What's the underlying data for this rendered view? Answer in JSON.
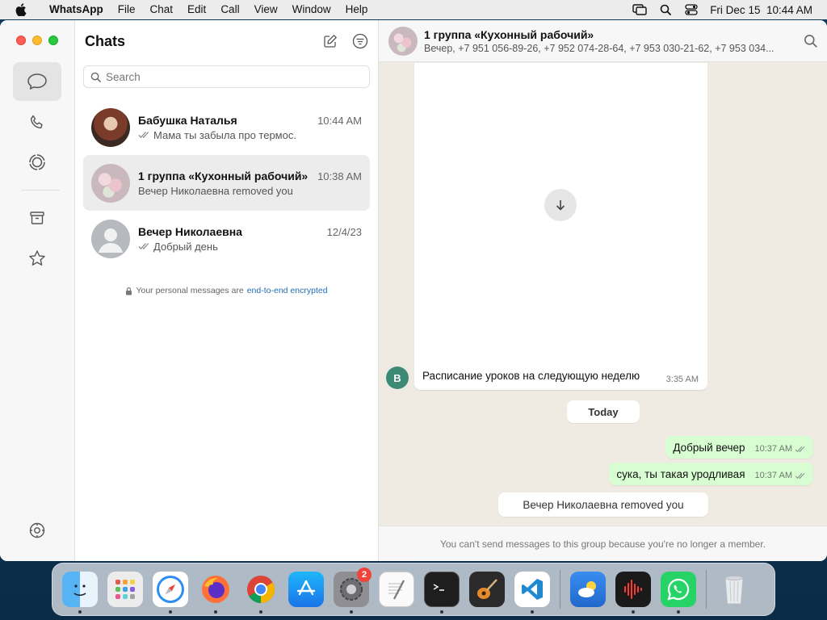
{
  "menubar": {
    "app_name": "WhatsApp",
    "menus": [
      "File",
      "Chat",
      "Edit",
      "Call",
      "View",
      "Window",
      "Help"
    ],
    "clock": "Fri Dec 15  10:44 AM"
  },
  "sidebar": {
    "title": "Chats",
    "search_placeholder": "Search",
    "chats": [
      {
        "name": "Бабушка Наталья",
        "time": "10:44 AM",
        "message": "Мама ты забыла про термос.",
        "ticks": true
      },
      {
        "name": "1 группа «Кухонный рабочий»",
        "time": "10:38 AM",
        "message": "Вечер Николаевна removed you",
        "ticks": false
      },
      {
        "name": "Вечер Николаевна",
        "time": "12/4/23",
        "message": "Добрый день",
        "ticks": true
      }
    ],
    "encryption_prefix": "Your personal messages are",
    "encryption_link": "end-to-end encrypted"
  },
  "conversation": {
    "title": "1 группа «Кухонный рабочий»",
    "subtitle": "Вечер, +7 951 056-89-26, +7 952 074-28-64, +7 953 030-21-62, +7 953 034...",
    "media_caption": "Расписание уроков на следующую неделю",
    "media_time": "3:35 AM",
    "sender_initial": "B",
    "date_separator": "Today",
    "outgoing": [
      {
        "text": "Добрый вечер",
        "time": "10:37 AM"
      },
      {
        "text": "сука, ты такая уродливая",
        "time": "10:37 AM"
      }
    ],
    "system_message": "Вечер Николаевна removed you",
    "footer_notice": "You can't send messages to this group because you're no longer a member."
  },
  "dock": {
    "apps": [
      "finder",
      "launchpad",
      "safari",
      "firefox",
      "chrome",
      "app-store",
      "system-settings",
      "textedit",
      "terminal",
      "garageband",
      "vscode",
      "weather",
      "voice-memos",
      "whatsapp",
      "trash"
    ],
    "settings_badge": "2"
  },
  "colors": {
    "outgoing_bubble": "#d9fdd3",
    "chat_background": "#efeae2",
    "link": "#1f6fb5",
    "badge": "#f0433a"
  }
}
